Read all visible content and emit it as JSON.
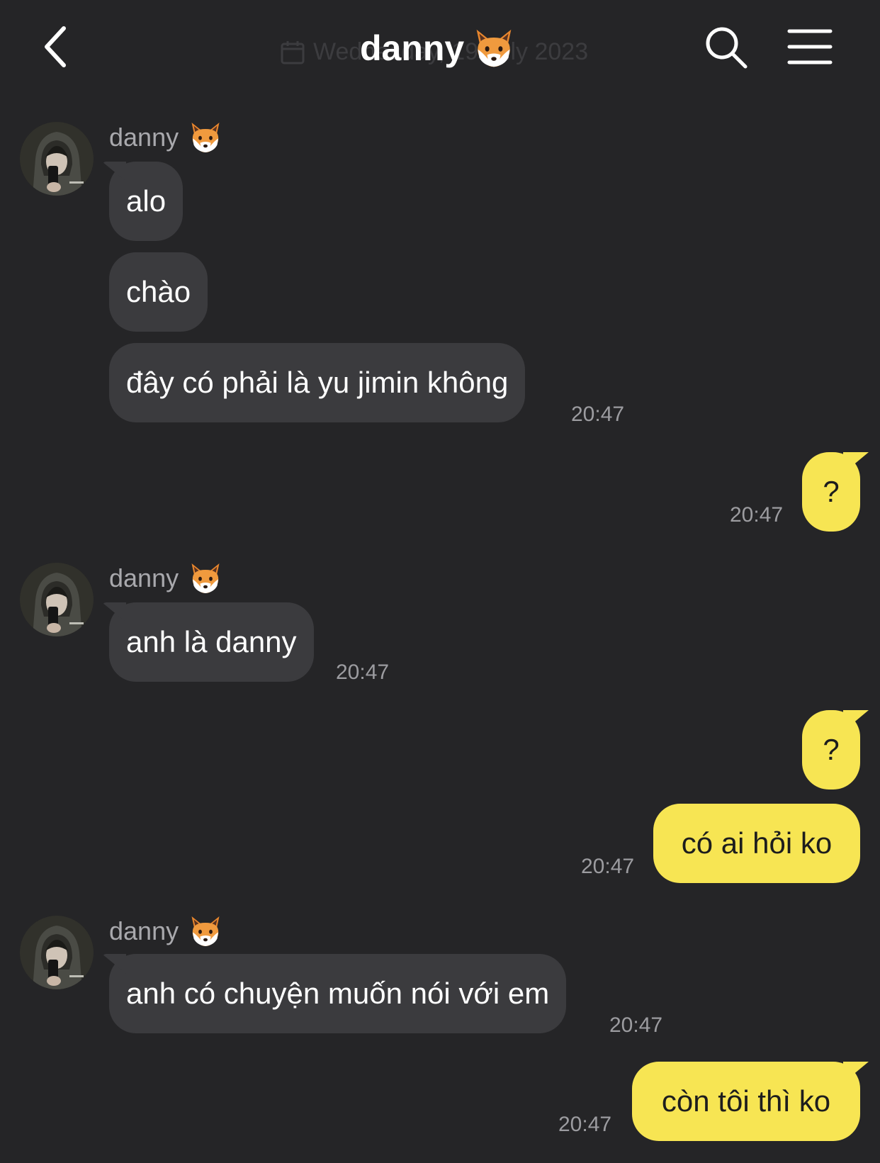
{
  "header": {
    "title": "danny",
    "date_ghost": "Wednesday, 19 July 2023"
  },
  "colors": {
    "background": "#252527",
    "incoming_bubble": "#3b3b3e",
    "outgoing_bubble": "#f7e553",
    "timestamp": "#9c9ca0"
  },
  "icons": {
    "back": "chevron-left-icon",
    "search": "search-icon",
    "menu": "hamburger-menu-icon",
    "fox": "fox-emoji-icon",
    "calendar": "calendar-icon"
  },
  "messages": [
    {
      "sender": "danny",
      "items": [
        "alo",
        "chào",
        "đây có phải là yu jimin không"
      ],
      "time": "20:47"
    },
    {
      "direction": "out",
      "items": [
        "?"
      ],
      "time": "20:47"
    },
    {
      "sender": "danny",
      "items": [
        "anh là danny"
      ],
      "time": "20:47"
    },
    {
      "direction": "out",
      "items": [
        "?",
        "có ai hỏi ko"
      ],
      "time": "20:47"
    },
    {
      "sender": "danny",
      "items": [
        "anh có chuyện muốn nói với em"
      ],
      "time": "20:47"
    },
    {
      "direction": "out",
      "items": [
        "còn tôi thì ko"
      ],
      "time": "20:47"
    }
  ]
}
